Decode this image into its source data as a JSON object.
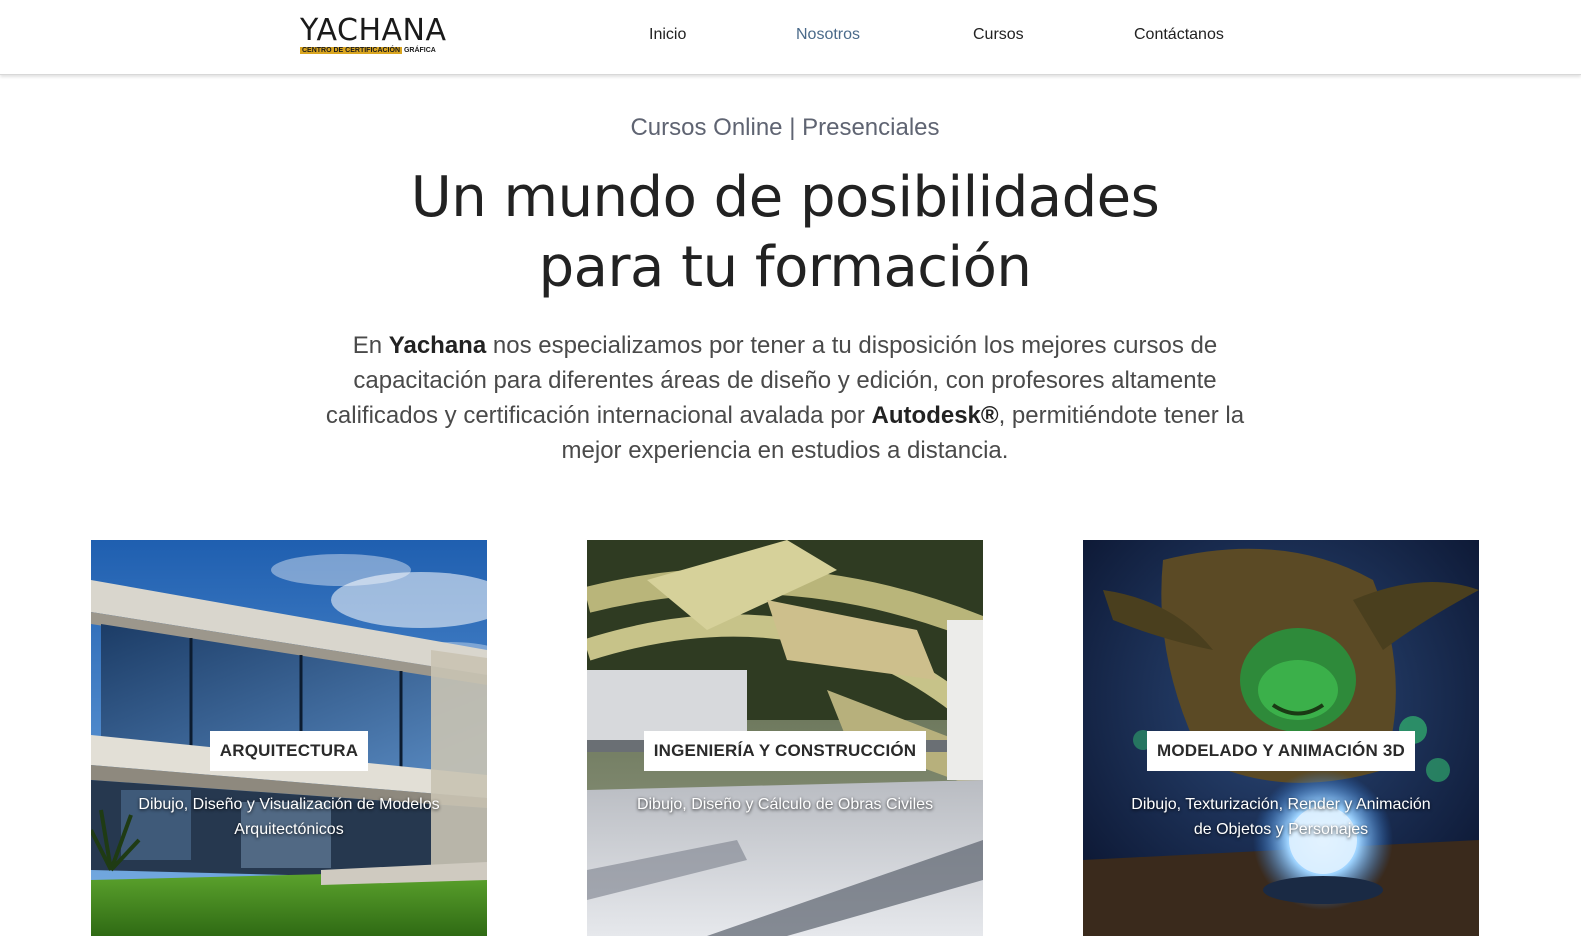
{
  "brand": {
    "name": "YACHANA",
    "tagline_highlight": "CENTRO DE CERTIFICACIÓN",
    "tagline_rest": "GRÁFICA",
    "accent_color": "#d9a520"
  },
  "nav": {
    "items": [
      {
        "label": "Inicio",
        "active": false
      },
      {
        "label": "Nosotros",
        "active": true
      },
      {
        "label": "Cursos",
        "active": false
      },
      {
        "label": "Contáctanos",
        "active": false
      }
    ]
  },
  "hero": {
    "eyebrow": "Cursos Online | Presenciales",
    "title_line1": "Un mundo de posibilidades",
    "title_line2": "para tu formación",
    "intro": {
      "part1": "En ",
      "bold1": "Yachana",
      "part2": " nos especializamos por tener a tu disposición los mejores cursos de capacitación para diferentes áreas de diseño y edición, con profesores altamente calificados y certificación internacional avalada por ",
      "bold2": "Autodesk®",
      "part3": ", permitiéndote tener la mejor experiencia en estudios a distancia."
    }
  },
  "cards": [
    {
      "title": "ARQUITECTURA",
      "description": "Dibujo, Diseño y Visualización de Modelos Arquitectónicos",
      "image": "modern-house-render"
    },
    {
      "title": "INGENIERÍA Y CONSTRUCCIÓN",
      "description": "Dibujo, Diseño y Cálculo de Obras Civiles",
      "image": "structural-canopy-render"
    },
    {
      "title": "MODELADO Y ANIMACIÓN 3D",
      "description": "Dibujo, Texturización, Render y Animación de Objetos y Personajes",
      "image": "goblin-character-render"
    }
  ]
}
